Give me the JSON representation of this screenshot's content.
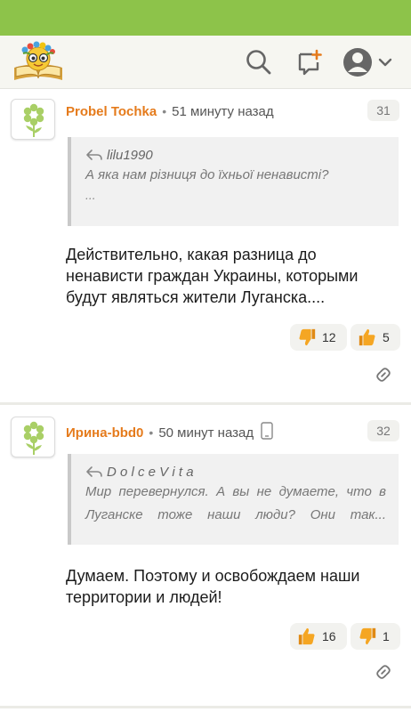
{
  "header": {
    "logo": "books-mascot-logo",
    "search_icon": "search-icon",
    "new_post_icon": "new-post-icon",
    "avatar_icon": "user-avatar-icon",
    "menu_icon": "chevron-down-icon"
  },
  "colors": {
    "top_bar": "#8dc34a",
    "header_bg": "#f6f6f1",
    "author": "#e57b1c",
    "thumb": "#f5a623"
  },
  "comments": [
    {
      "author": "Probel Tochka",
      "time": "51 минуту назад",
      "number": "31",
      "quote_author": "lilu1990",
      "quote_lines": [
        "А яка нам різниця до їхньої ненависті?"
      ],
      "quote_more": "...",
      "text_lines": [
        "Действительно, какая разница до",
        "ненависти граждан Украины, которыми",
        "будут являться жители Луганска...."
      ],
      "dislikes": "12",
      "likes": "5"
    },
    {
      "author": "Ирина-bbd0",
      "time": "50 минут назад",
      "device_icon": "mobile-phone-icon",
      "number": "32",
      "quote_author": "D o l c e V i t a",
      "quote_lines": [
        "Мир перевернулся. А вы не думаете, что в",
        "Луганске тоже наши люди? Они так..."
      ],
      "text_lines": [
        "Думаем. Поэтому и освобождаем наши",
        "территории и людей!"
      ],
      "likes": "16",
      "dislikes": "1"
    }
  ]
}
